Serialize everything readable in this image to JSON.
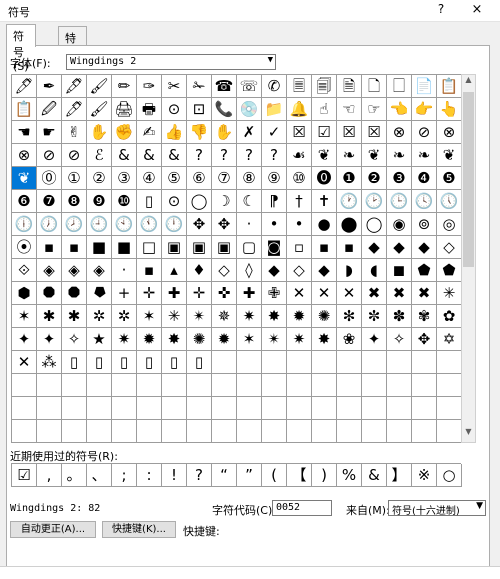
{
  "window": {
    "title": "符号",
    "help": "?",
    "close": "×"
  },
  "tabs": [
    {
      "label": "符号(S)"
    },
    {
      "label": "特殊字符(P)"
    }
  ],
  "font": {
    "label": "字体(F):",
    "value": "Wingdings 2"
  },
  "grid": {
    "selected_index": 72,
    "rows": [
      [
        "🖊",
        "✒",
        "🖋",
        "🖌",
        "✏",
        "✑",
        "✂",
        "✁",
        "☎",
        "☏",
        "✆",
        "🗏",
        "🗐",
        "🗎",
        "🗋",
        "🗌",
        "📄",
        "📋"
      ],
      [
        "📋",
        "🖉",
        "🖊",
        "🖌",
        "🖨",
        "🖶",
        "⊙",
        "⊡",
        "📞",
        "💿",
        "📁",
        "🔔",
        "☝",
        "☜",
        "☞",
        "👈",
        "👉",
        "👆"
      ],
      [
        "☚",
        "☛",
        "✌",
        "✋",
        "✊",
        "✍",
        "👍",
        "👎",
        "✋",
        "✗",
        "✓",
        "☒",
        "☑",
        "☒",
        "☒",
        "⊗",
        "⊘",
        "⊗"
      ],
      [
        "⊗",
        "⊘",
        "⊘",
        "ℰ",
        "&",
        "&",
        "&",
        "?",
        "?",
        "?",
        "?",
        "☙",
        "❦",
        "❧",
        "❦",
        "❧",
        "❧",
        "❦"
      ],
      [
        "❦",
        "⓪",
        "①",
        "②",
        "③",
        "④",
        "⑤",
        "⑥",
        "⑦",
        "⑧",
        "⑨",
        "⑩",
        "⓿",
        "❶",
        "❷",
        "❸",
        "❹",
        "❺"
      ],
      [
        "❻",
        "❼",
        "❽",
        "❾",
        "❿",
        "▯",
        "⊙",
        "◯",
        "☽",
        "☾",
        "⁋",
        "†",
        "✝",
        "🕐",
        "🕑",
        "🕒",
        "🕓",
        "🕔"
      ],
      [
        "🕕",
        "🕖",
        "🕗",
        "🕘",
        "🕙",
        "🕚",
        "🕛",
        "✥",
        "✥",
        "·",
        "•",
        "•",
        "●",
        "⬤",
        "◯",
        "◉",
        "⊚",
        "◎"
      ],
      [
        "⦿",
        "▪",
        "▪",
        "■",
        "■",
        "□",
        "▣",
        "▣",
        "▣",
        "▢",
        "◙",
        "▫",
        "▪",
        "▪",
        "◆",
        "◆",
        "◆",
        "◇"
      ],
      [
        "⟐",
        "◈",
        "◈",
        "◈",
        "·",
        "▪",
        "▴",
        "♦",
        "◇",
        "◊",
        "◆",
        "◇",
        "◆",
        "◗",
        "◖",
        "◼",
        "⬟",
        "⬟"
      ],
      [
        "⬢",
        "⯃",
        "⯃",
        "⯂",
        "+",
        "✛",
        "✚",
        "✛",
        "✜",
        "✚",
        "✙",
        "✕",
        "✕",
        "✕",
        "✖",
        "✖",
        "✖",
        "✳"
      ],
      [
        "✶",
        "✱",
        "✱",
        "✲",
        "✲",
        "✶",
        "✳",
        "✴",
        "✵",
        "✷",
        "✸",
        "✹",
        "✺",
        "✻",
        "✼",
        "✽",
        "✾",
        "✿"
      ],
      [
        "✦",
        "✦",
        "✧",
        "★",
        "✷",
        "✹",
        "✸",
        "✺",
        "✹",
        "✶",
        "✴",
        "✷",
        "✸",
        "❀",
        "✦",
        "✧",
        "✥",
        "✡"
      ],
      [
        "✕",
        "⁂",
        "▯",
        "▯",
        "▯",
        "▯",
        "▯",
        "▯",
        "",
        "",
        "",
        "",
        "",
        "",
        "",
        "",
        "",
        ""
      ]
    ]
  },
  "recent": {
    "label": "近期使用过的符号(R):",
    "symbols": [
      "☑",
      ",",
      "。",
      "、",
      ";",
      ":",
      "!",
      "?",
      "“",
      "”",
      "(",
      "【",
      ")",
      "%",
      "&",
      "】",
      "※",
      "○"
    ]
  },
  "status": {
    "char_name": "Wingdings 2: 82",
    "code_label": "字符代码(C):",
    "code_value": "0052",
    "from_label": "来自(M):",
    "from_value": "符号(十六进制)"
  },
  "buttons": {
    "autocorrect": "自动更正(A)...",
    "shortcut_key": "快捷键(K)...",
    "shortcut_text": "快捷键:"
  }
}
